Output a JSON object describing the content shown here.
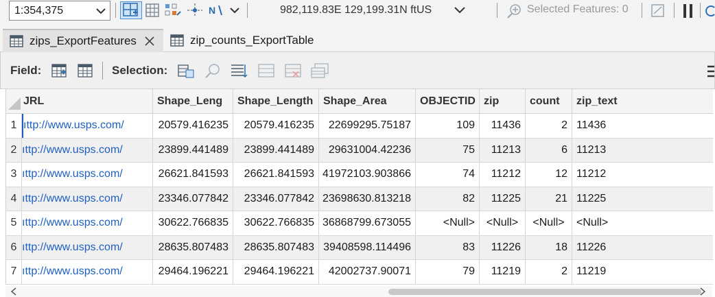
{
  "toolbar": {
    "scale_value": "1:354,375",
    "coordinates": "982,119.83E 129,199.31N ftUS",
    "selected_features": "Selected Features: 0"
  },
  "tabs": [
    {
      "label": "zips_ExportFeatures",
      "active": true,
      "icon": "table-icon"
    },
    {
      "label": "zip_counts_ExportTable",
      "active": false,
      "icon": "table-icon"
    }
  ],
  "fieldbar": {
    "field_label": "Field:",
    "selection_label": "Selection:"
  },
  "table": {
    "columns": [
      "URL",
      "Shape_Leng",
      "Shape_Length",
      "Shape_Area",
      "OBJECTID",
      "zip",
      "count",
      "zip_text"
    ],
    "columns_visible": [
      "JRL",
      "Shape_Leng",
      "Shape_Length",
      "Shape_Area",
      "OBJECTID",
      "zip",
      "count",
      "zip_text"
    ],
    "rows": [
      {
        "num": "1",
        "url": "ıttp://www.usps.com/",
        "shape_leng": "20579.416235",
        "shape_length": "20579.416235",
        "shape_area": "22699295.75187",
        "objectid": "109",
        "zip": "11436",
        "count": "2",
        "zip_text": "11436"
      },
      {
        "num": "2",
        "url": "ıttp://www.usps.com/",
        "shape_leng": "23899.441489",
        "shape_length": "23899.441489",
        "shape_area": "29631004.42236",
        "objectid": "75",
        "zip": "11213",
        "count": "6",
        "zip_text": "11213"
      },
      {
        "num": "3",
        "url": "ıttp://www.usps.com/",
        "shape_leng": "26621.841593",
        "shape_length": "26621.841593",
        "shape_area": "41972103.903866",
        "objectid": "74",
        "zip": "11212",
        "count": "12",
        "zip_text": "11212"
      },
      {
        "num": "4",
        "url": "ıttp://www.usps.com/",
        "shape_leng": "23346.077842",
        "shape_length": "23346.077842",
        "shape_area": "23698630.813218",
        "objectid": "82",
        "zip": "11225",
        "count": "21",
        "zip_text": "11225"
      },
      {
        "num": "5",
        "url": "ıttp://www.usps.com/",
        "shape_leng": "30622.766835",
        "shape_length": "30622.766835",
        "shape_area": "36868799.673055",
        "objectid": "<Null>",
        "zip": "<Null>",
        "count": "<Null>",
        "zip_text": "<Null>"
      },
      {
        "num": "6",
        "url": "ıttp://www.usps.com/",
        "shape_leng": "28635.807483",
        "shape_length": "28635.807483",
        "shape_area": "39408598.114496",
        "objectid": "83",
        "zip": "11226",
        "count": "18",
        "zip_text": "11226"
      },
      {
        "num": "7",
        "url": "ıttp://www.usps.com/",
        "shape_leng": "29464.196221",
        "shape_length": "29464.196221",
        "shape_area": "42002737.90071",
        "objectid": "79",
        "zip": "11219",
        "count": "2",
        "zip_text": "11219"
      }
    ]
  },
  "colors": {
    "link": "#1f5fbf",
    "active_tool_bg": "#cfe3f6",
    "alt_row": "#f0f0f0"
  }
}
